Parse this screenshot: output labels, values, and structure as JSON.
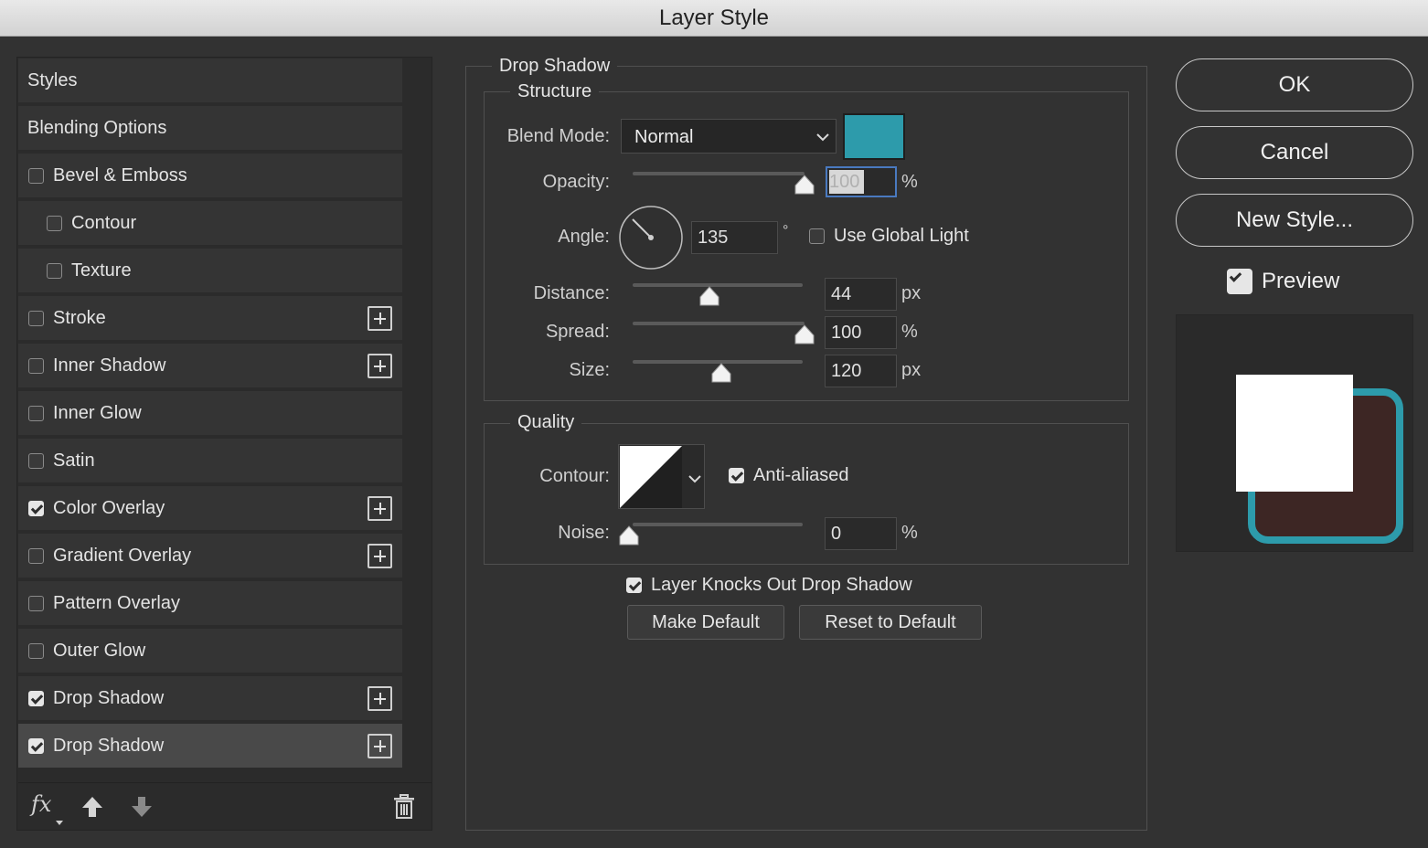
{
  "window": {
    "title": "Layer Style"
  },
  "styles_list": [
    {
      "label": "Styles",
      "checkbox": false,
      "checked": false,
      "indent": false,
      "plus": false,
      "selected": false
    },
    {
      "label": "Blending Options",
      "checkbox": false,
      "checked": false,
      "indent": false,
      "plus": false,
      "selected": false
    },
    {
      "label": "Bevel & Emboss",
      "checkbox": true,
      "checked": false,
      "indent": false,
      "plus": false,
      "selected": false
    },
    {
      "label": "Contour",
      "checkbox": true,
      "checked": false,
      "indent": true,
      "plus": false,
      "selected": false
    },
    {
      "label": "Texture",
      "checkbox": true,
      "checked": false,
      "indent": true,
      "plus": false,
      "selected": false
    },
    {
      "label": "Stroke",
      "checkbox": true,
      "checked": false,
      "indent": false,
      "plus": true,
      "selected": false
    },
    {
      "label": "Inner Shadow",
      "checkbox": true,
      "checked": false,
      "indent": false,
      "plus": true,
      "selected": false
    },
    {
      "label": "Inner Glow",
      "checkbox": true,
      "checked": false,
      "indent": false,
      "plus": false,
      "selected": false
    },
    {
      "label": "Satin",
      "checkbox": true,
      "checked": false,
      "indent": false,
      "plus": false,
      "selected": false
    },
    {
      "label": "Color Overlay",
      "checkbox": true,
      "checked": true,
      "indent": false,
      "plus": true,
      "selected": false
    },
    {
      "label": "Gradient Overlay",
      "checkbox": true,
      "checked": false,
      "indent": false,
      "plus": true,
      "selected": false
    },
    {
      "label": "Pattern Overlay",
      "checkbox": true,
      "checked": false,
      "indent": false,
      "plus": false,
      "selected": false
    },
    {
      "label": "Outer Glow",
      "checkbox": true,
      "checked": false,
      "indent": false,
      "plus": false,
      "selected": false
    },
    {
      "label": "Drop Shadow",
      "checkbox": true,
      "checked": true,
      "indent": false,
      "plus": true,
      "selected": false
    },
    {
      "label": "Drop Shadow",
      "checkbox": true,
      "checked": true,
      "indent": false,
      "plus": true,
      "selected": true
    }
  ],
  "footer": {
    "fx_label": "fx",
    "icons": [
      "fx-icon",
      "move-up-arrow-icon",
      "move-down-arrow-icon",
      "trash-icon"
    ]
  },
  "drop_shadow": {
    "section_title": "Drop Shadow",
    "structure": {
      "title": "Structure",
      "blend_mode_label": "Blend Mode:",
      "blend_mode_value": "Normal",
      "shadow_color": "#2d9bab",
      "opacity_label": "Opacity:",
      "opacity_value": "100",
      "opacity_unit": "%",
      "opacity_level": 1.0,
      "angle_label": "Angle:",
      "angle_value": "135",
      "angle_unit": "°",
      "use_global_light_label": "Use Global Light",
      "use_global_light_checked": false,
      "distance_label": "Distance:",
      "distance_value": "44",
      "distance_unit": "px",
      "distance_level": 0.45,
      "spread_label": "Spread:",
      "spread_value": "100",
      "spread_unit": "%",
      "spread_level": 1.0,
      "size_label": "Size:",
      "size_value": "120",
      "size_unit": "px",
      "size_level": 0.52
    },
    "quality": {
      "title": "Quality",
      "contour_label": "Contour:",
      "anti_aliased_label": "Anti-aliased",
      "anti_aliased_checked": true,
      "noise_label": "Noise:",
      "noise_value": "0",
      "noise_unit": "%",
      "noise_level": 0.0
    },
    "knockout_label": "Layer Knocks Out Drop Shadow",
    "knockout_checked": true,
    "make_default_label": "Make Default",
    "reset_default_label": "Reset to Default"
  },
  "actions": {
    "ok_label": "OK",
    "cancel_label": "Cancel",
    "new_style_label": "New Style...",
    "preview_label": "Preview",
    "preview_checked": true
  },
  "preview_colors": {
    "fill": "#ffffff",
    "shape": "#3d2624",
    "stroke": "#2d9bab"
  }
}
